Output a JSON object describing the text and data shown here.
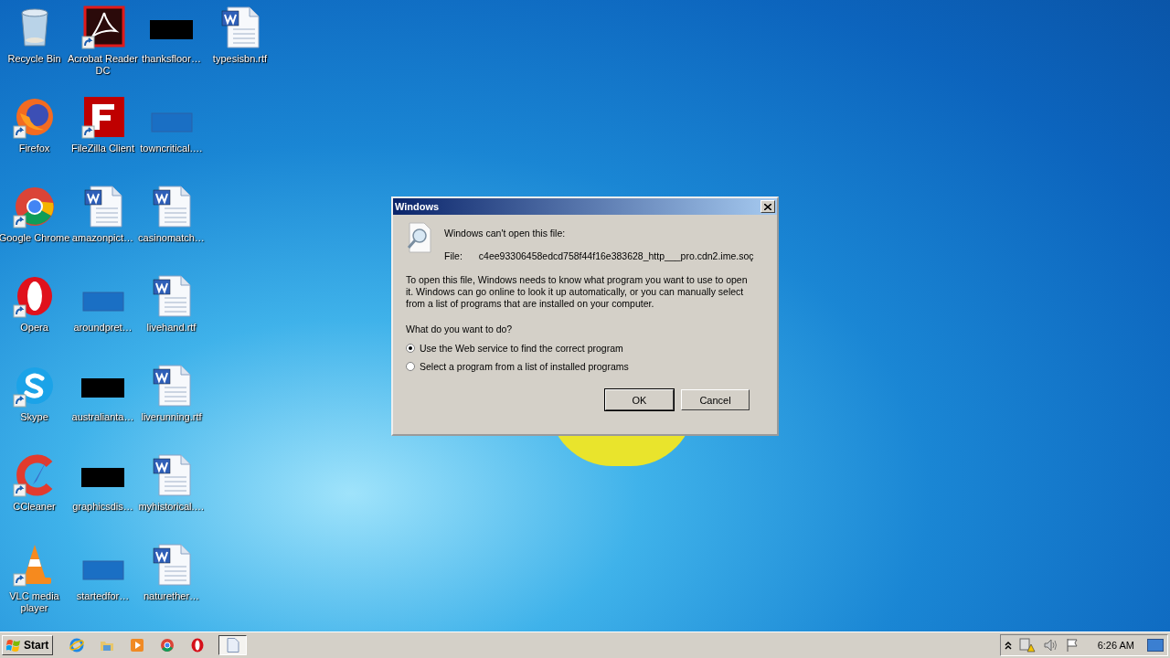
{
  "desktop": {
    "icons": [
      {
        "label": "Recycle Bin",
        "kind": "recycle",
        "shortcut": false
      },
      {
        "label": "Firefox",
        "kind": "firefox",
        "shortcut": true
      },
      {
        "label": "Google Chrome",
        "kind": "chrome",
        "shortcut": true
      },
      {
        "label": "Opera",
        "kind": "opera",
        "shortcut": true
      },
      {
        "label": "Skype",
        "kind": "skype",
        "shortcut": true
      },
      {
        "label": "CCleaner",
        "kind": "ccleaner",
        "shortcut": true
      },
      {
        "label": "VLC media player",
        "kind": "vlc",
        "shortcut": true
      },
      {
        "label": "Acrobat Reader DC",
        "kind": "acrobat",
        "shortcut": true
      },
      {
        "label": "FileZilla Client",
        "kind": "filezilla",
        "shortcut": true
      },
      {
        "label": "amazonpict…",
        "kind": "word",
        "shortcut": false
      },
      {
        "label": "aroundpret…",
        "kind": "blank",
        "shortcut": false
      },
      {
        "label": "australianta…",
        "kind": "black",
        "shortcut": false
      },
      {
        "label": "graphicsdis…",
        "kind": "black",
        "shortcut": false
      },
      {
        "label": "startedfor…",
        "kind": "blank",
        "shortcut": false
      },
      {
        "label": "thanksfloor…",
        "kind": "black",
        "shortcut": false
      },
      {
        "label": "towncritical.…",
        "kind": "blank",
        "shortcut": false
      },
      {
        "label": "casinomatch…",
        "kind": "word",
        "shortcut": false
      },
      {
        "label": "livehand.rtf",
        "kind": "word",
        "shortcut": false
      },
      {
        "label": "liverunning.rtf",
        "kind": "word",
        "shortcut": false
      },
      {
        "label": "myhistorical.…",
        "kind": "word",
        "shortcut": false
      },
      {
        "label": "naturether…",
        "kind": "word",
        "shortcut": false
      },
      {
        "label": "typesisbn.rtf",
        "kind": "word",
        "shortcut": false
      }
    ]
  },
  "dialog": {
    "title": "Windows",
    "heading": "Windows can't open this file:",
    "file_label": "File:",
    "file_name": "c4ee93306458edcd758f44f16e383628_http___pro.cdn2.ime.soç",
    "description": "To open this file, Windows needs to know what program you want to use to open it. Windows can go online to look it up automatically, or you can manually select from a list of programs that are installed on your computer.",
    "question": "What do you want to do?",
    "options": [
      {
        "label": "Use the Web service to find the correct program",
        "selected": true
      },
      {
        "label": "Select a program from a list of installed programs",
        "selected": false
      }
    ],
    "buttons": [
      {
        "label": "OK",
        "default": true
      },
      {
        "label": "Cancel",
        "default": false
      }
    ]
  },
  "taskbar": {
    "start": "Start",
    "pinned": [
      {
        "kind": "ie"
      },
      {
        "kind": "explorer"
      },
      {
        "kind": "media"
      },
      {
        "kind": "chrome"
      },
      {
        "kind": "opera"
      }
    ],
    "windows": [
      {
        "kind": "document",
        "selected": true
      }
    ],
    "clock": "6:26 AM"
  }
}
